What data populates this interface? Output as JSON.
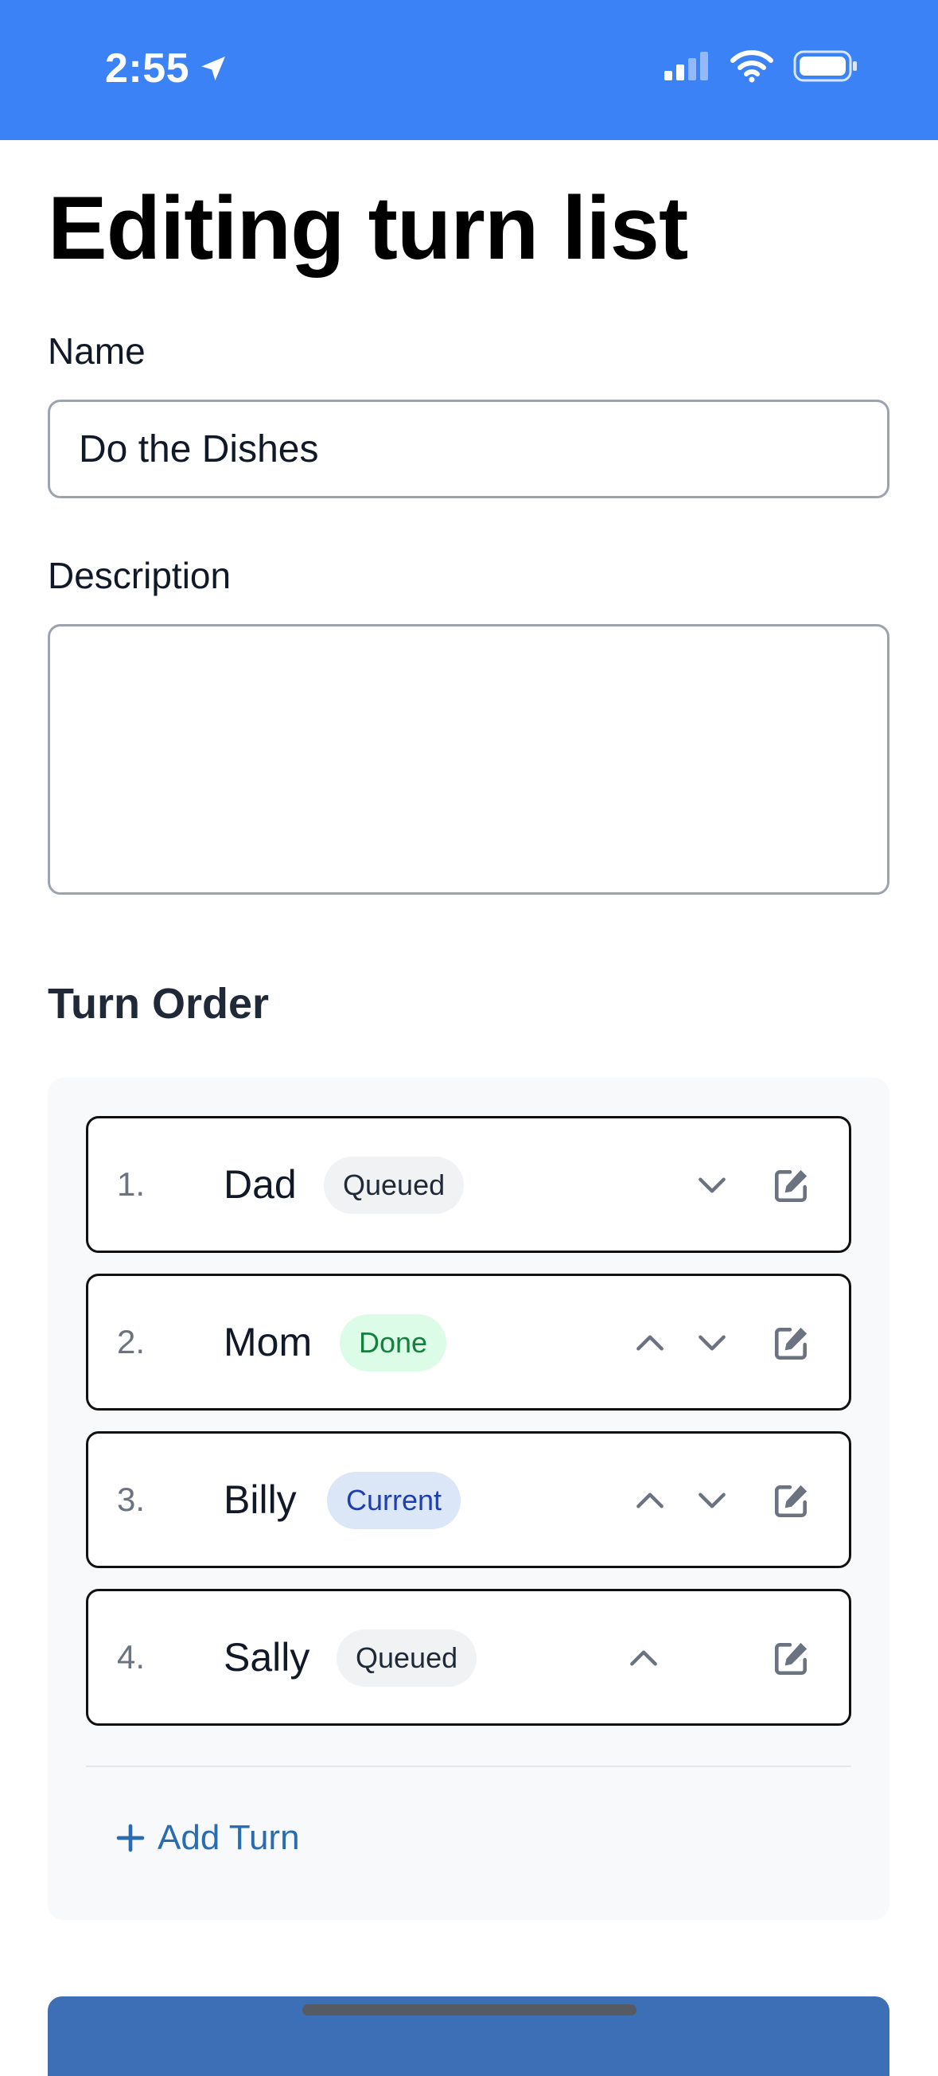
{
  "status_bar": {
    "time": "2:55",
    "icons": [
      "location-arrow-icon",
      "signal-icon",
      "wifi-icon",
      "battery-icon"
    ]
  },
  "page": {
    "title": "Editing turn list"
  },
  "form": {
    "name_label": "Name",
    "name_value": "Do the Dishes",
    "description_label": "Description",
    "description_value": ""
  },
  "turn_order": {
    "title": "Turn Order",
    "turns": [
      {
        "number": "1.",
        "name": "Dad",
        "status": "Queued",
        "can_move_up": false,
        "can_move_down": true
      },
      {
        "number": "2.",
        "name": "Mom",
        "status": "Done",
        "can_move_up": true,
        "can_move_down": true
      },
      {
        "number": "3.",
        "name": "Billy",
        "status": "Current",
        "can_move_up": true,
        "can_move_down": true
      },
      {
        "number": "4.",
        "name": "Sally",
        "status": "Queued",
        "can_move_up": true,
        "can_move_down": false
      }
    ],
    "add_turn_label": "Add Turn"
  },
  "colors": {
    "header": "#3b82f6",
    "accent_link": "#2b6cb0",
    "done_badge_bg": "#dcfce7",
    "current_badge_bg": "#dbe6f7",
    "queued_badge_bg": "#f1f2f4"
  }
}
